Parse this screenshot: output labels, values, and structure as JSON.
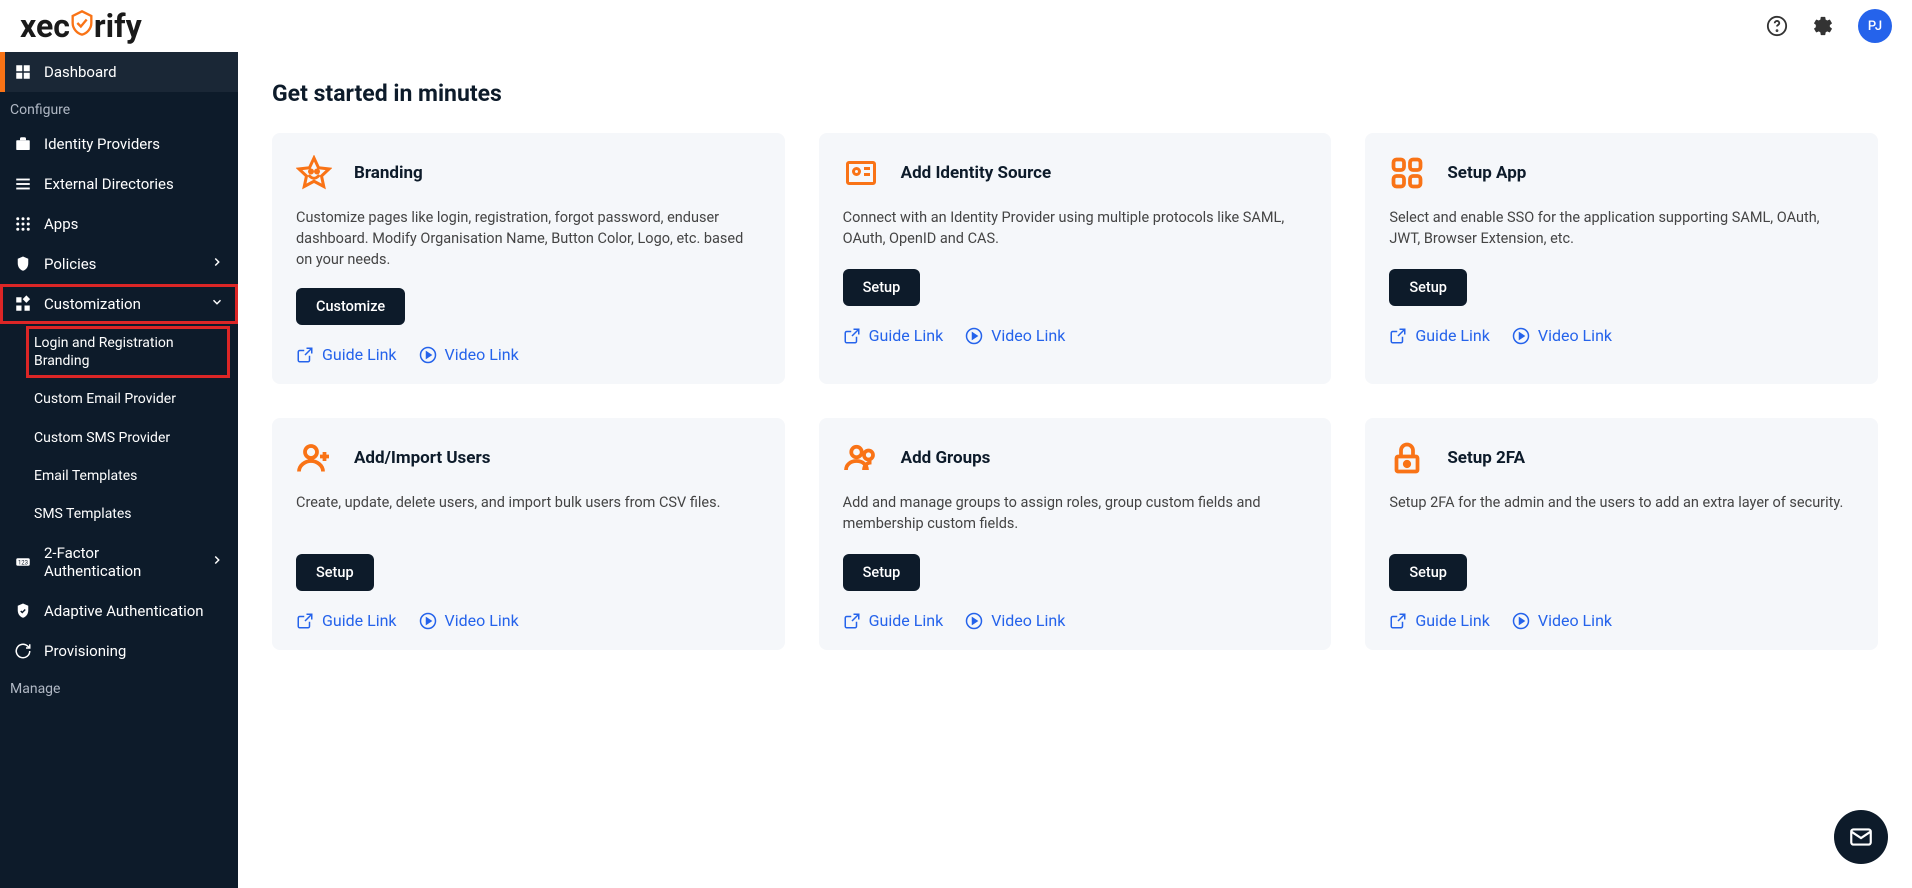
{
  "header": {
    "logo": "xecurify",
    "avatar": "PJ"
  },
  "sidebar": {
    "section_configure": "Configure",
    "section_manage": "Manage",
    "items": {
      "dashboard": "Dashboard",
      "identity_providers": "Identity Providers",
      "external_directories": "External Directories",
      "apps": "Apps",
      "policies": "Policies",
      "customization": "Customization",
      "two_factor": "2-Factor Authentication",
      "adaptive": "Adaptive Authentication",
      "provisioning": "Provisioning"
    },
    "sub": {
      "login_branding": "Login and Registration Branding",
      "custom_email": "Custom Email Provider",
      "custom_sms": "Custom SMS Provider",
      "email_templates": "Email Templates",
      "sms_templates": "SMS Templates"
    }
  },
  "main": {
    "title": "Get started in minutes",
    "cards": [
      {
        "title": "Branding",
        "desc": "Customize pages like login, registration, forgot password, enduser dashboard. Modify Organisation Name, Button Color, Logo, etc. based on your needs.",
        "btn": "Customize",
        "guide": "Guide Link",
        "video": "Video Link",
        "icon": "star"
      },
      {
        "title": "Add Identity Source",
        "desc": "Connect with an Identity Provider using multiple protocols like SAML, OAuth, OpenID and CAS.",
        "btn": "Setup",
        "guide": "Guide Link",
        "video": "Video Link",
        "icon": "id"
      },
      {
        "title": "Setup App",
        "desc": "Select and enable SSO for the application supporting SAML, OAuth, JWT, Browser Extension, etc.",
        "btn": "Setup",
        "guide": "Guide Link",
        "video": "Video Link",
        "icon": "apps"
      },
      {
        "title": "Add/Import Users",
        "desc": "Create, update, delete users, and import bulk users from CSV files.",
        "btn": "Setup",
        "guide": "Guide Link",
        "video": "Video Link",
        "icon": "user"
      },
      {
        "title": "Add Groups",
        "desc": "Add and manage groups to assign roles, group custom fields and membership custom fields.",
        "btn": "Setup",
        "guide": "Guide Link",
        "video": "Video Link",
        "icon": "group"
      },
      {
        "title": "Setup 2FA",
        "desc": "Setup 2FA for the admin and the users to add an extra layer of security.",
        "btn": "Setup",
        "guide": "Guide Link",
        "video": "Video Link",
        "icon": "lock"
      }
    ]
  }
}
